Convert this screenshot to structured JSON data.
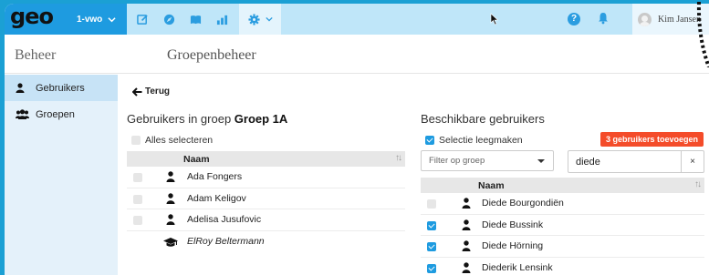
{
  "topbar": {
    "logo": "geo",
    "class_select": "1-vwo",
    "nav_icons": [
      "edit-icon",
      "compass-icon",
      "book-icon",
      "chart-icon",
      "gear-icon"
    ],
    "user_name": "Kim Jansen"
  },
  "header": {
    "section_title": "Beheer",
    "page_title": "Groepenbeheer"
  },
  "sidebar": {
    "items": [
      {
        "label": "Gebruikers",
        "icon": "user-icon",
        "active": true
      },
      {
        "label": "Groepen",
        "icon": "users-icon",
        "active": false
      }
    ]
  },
  "main": {
    "back_label": "Terug",
    "group_heading_prefix": "Gebruikers in groep ",
    "group_heading_group": "Groep 1A",
    "select_all_label": "Alles selecteren",
    "left_table": {
      "header": "Naam",
      "rows": [
        {
          "name": "Ada Fongers",
          "type": "student",
          "checked": false
        },
        {
          "name": "Adam Keligov",
          "type": "student",
          "checked": false
        },
        {
          "name": "Adelisa Jusufovic",
          "type": "student",
          "checked": false
        },
        {
          "name": "ElRoy Beltermann",
          "type": "teacher",
          "checked": false
        }
      ]
    },
    "available_heading": "Beschikbare gebruikers",
    "clear_selection_label": "Selectie leegmaken",
    "add_button_label": "3 gebruikers toevoegen",
    "filter_placeholder": "Filter op groep",
    "search_value": "diede",
    "clear_search_label": "×",
    "right_table": {
      "header": "Naam",
      "rows": [
        {
          "name": "Diede Bourgondiën",
          "checked": false
        },
        {
          "name": "Diede Bussink",
          "checked": true
        },
        {
          "name": "Diede Hörning",
          "checked": true
        },
        {
          "name": "Diederik Lensink",
          "checked": true
        }
      ]
    }
  },
  "colors": {
    "background": "#1ba0d4",
    "brand_blue": "#1e9be0",
    "topbar": "#bfe6f9",
    "sidebar": "#e4f1fa",
    "sidebar_active": "#c7e3f6",
    "add_button": "#f44c2a"
  }
}
